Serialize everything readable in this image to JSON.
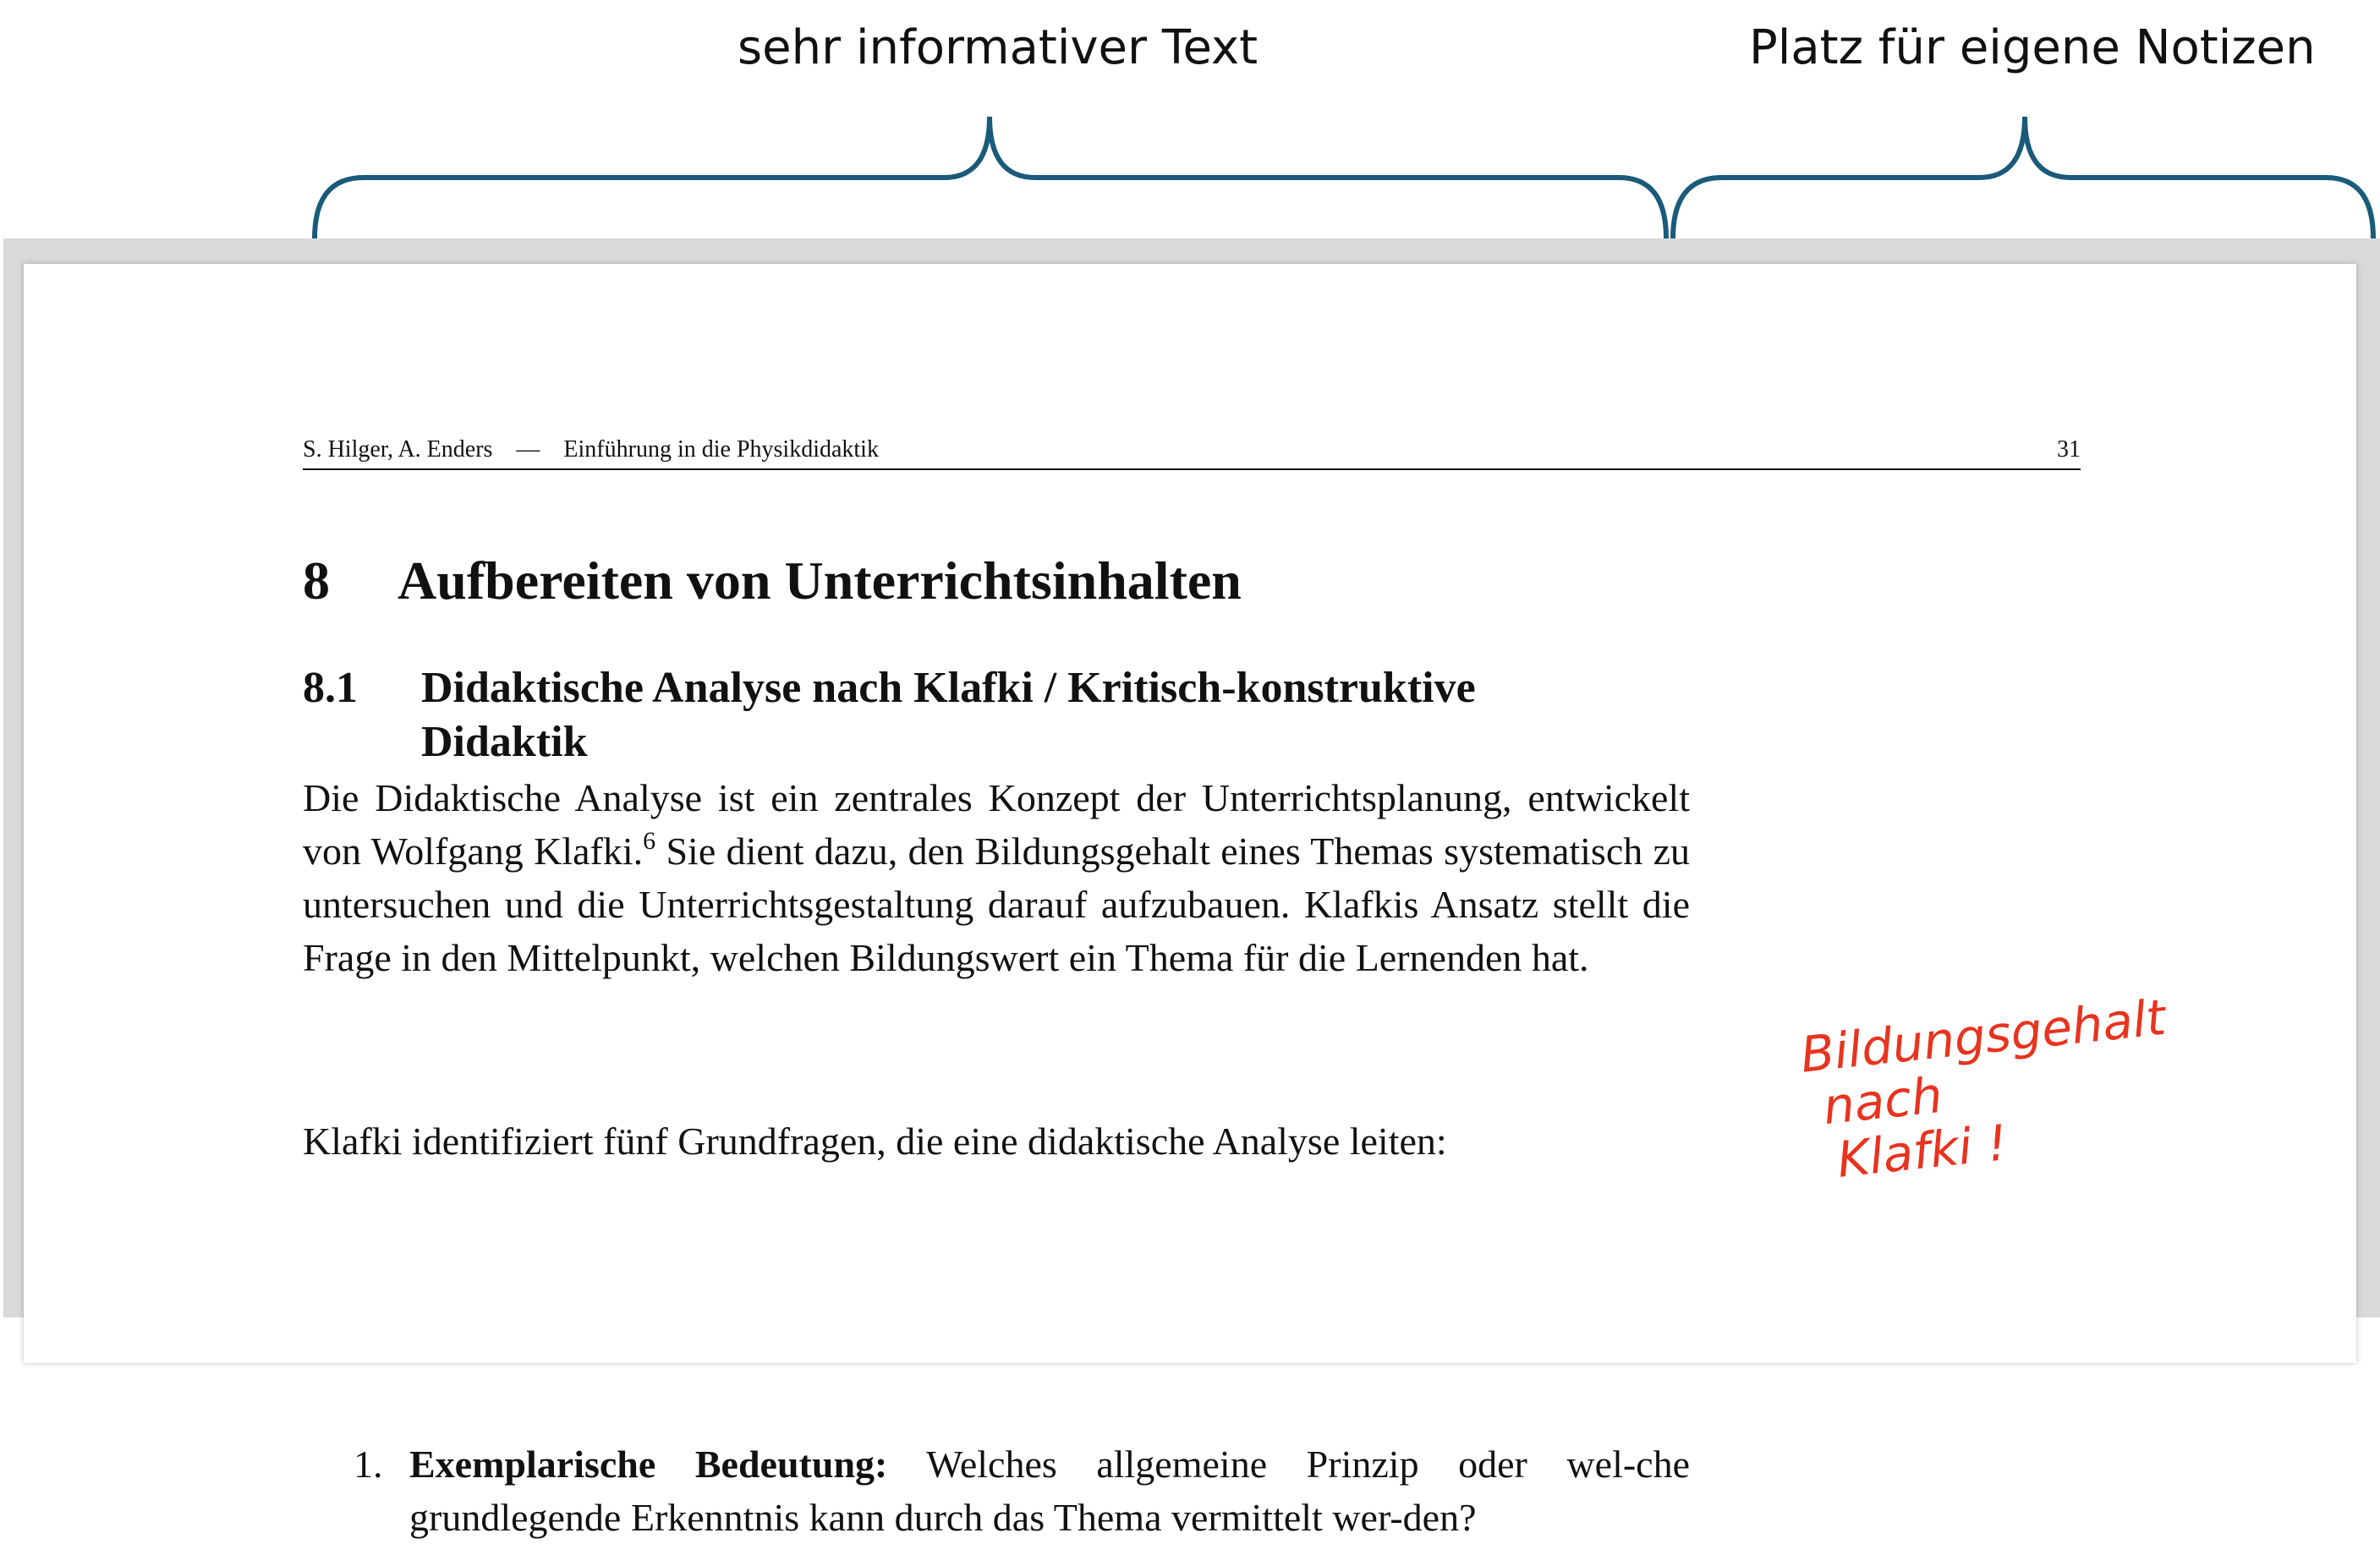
{
  "annotations": {
    "left_label": "sehr informativer Text",
    "right_label": "Platz für eigene Notizen",
    "brace_color": "#1a5a7a"
  },
  "page": {
    "running_head": {
      "authors": "S. Hilger, A. Enders",
      "separator": "—",
      "title": "Einführung in die Physikdidaktik",
      "page_number": "31"
    },
    "chapter": {
      "number": "8",
      "title": "Aufbereiten von Unterrichtsinhalten"
    },
    "section": {
      "number": "8.1",
      "title_line1": "Didaktische Analyse nach Klafki / Kritisch-konstruktive",
      "title_line2": "Didaktik"
    },
    "paragraph1": {
      "text_before_footnote": "Die Didaktische Analyse ist ein zentrales Konzept der Unterrichtsplanung, entwickelt von Wolfgang Klafki.",
      "footnote_mark": "6",
      "text_after_footnote": " Sie dient dazu, den Bildungsgehalt eines Themas systematisch zu untersuchen und die Unterrichtsgestaltung darauf aufzubauen. Klafkis Ansatz stellt die Frage in den Mittelpunkt, welchen Bildungswert ein Thema für die Lernenden hat."
    },
    "paragraph2": "Klafki identifiziert fünf Grundfragen, die eine didaktische Analyse leiten:",
    "list": [
      {
        "number": "1.",
        "bold": "Exemplarische Bedeutung:",
        "text": " Welches allgemeine Prinzip oder wel-che grundlegende Erkenntnis kann durch das Thema vermittelt wer-den?"
      }
    ],
    "handwritten_note": {
      "line1": "Bildungsgehalt",
      "line2": "nach",
      "line3": "Klafki !",
      "color": "#e8331e"
    }
  }
}
